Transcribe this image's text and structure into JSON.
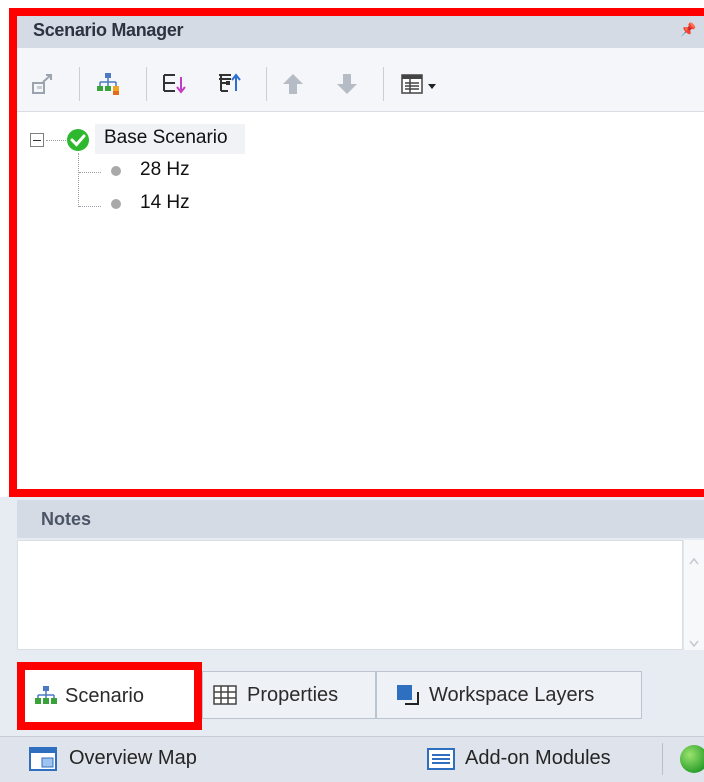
{
  "scenario_manager": {
    "title": "Scenario Manager",
    "pin_icon": "pin-icon",
    "toolbar": {
      "icons": [
        "promote-scenario-icon",
        "create-child-scenario-icon",
        "tree-sort-icon",
        "tree-filter-icon",
        "move-up-icon",
        "move-down-icon",
        "display-options-icon",
        "dropdown-arrow-icon"
      ]
    },
    "tree": {
      "root": {
        "label": "Base Scenario",
        "status": "current",
        "status_color": "#2db82d"
      },
      "children": [
        {
          "label": "28 Hz"
        },
        {
          "label": "14 Hz"
        }
      ]
    }
  },
  "notes": {
    "title": "Notes",
    "value": ""
  },
  "tabs": [
    {
      "label": "Scenario",
      "icon": "scenario-tree-icon",
      "selected": true
    },
    {
      "label": "Properties",
      "icon": "properties-grid-icon",
      "selected": false
    },
    {
      "label": "Workspace Layers",
      "icon": "workspace-layers-icon",
      "selected": false
    }
  ],
  "bottom_bar": {
    "overview_map": "Overview Map",
    "addon_modules": "Add-on Modules"
  },
  "highlight_color": "#ff0000"
}
